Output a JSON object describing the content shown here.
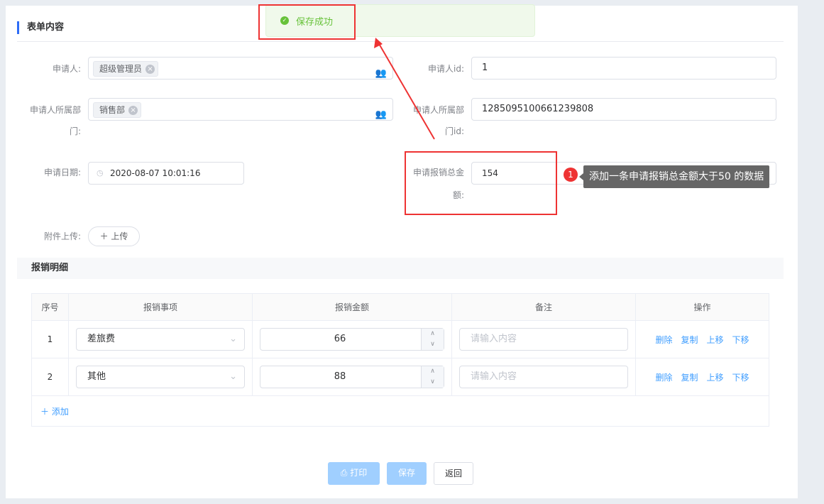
{
  "section_title": "表单内容",
  "toast": {
    "text": "保存成功"
  },
  "form": {
    "applicant_label": "申请人:",
    "applicant_tag": "超级管理员",
    "applicant_id_label": "申请人id:",
    "applicant_id": "1",
    "dept_label_1": "申请人所属部",
    "dept_label_2": "门:",
    "dept_tag": "销售部",
    "dept_id_label_1": "申请人所属部",
    "dept_id_label_2": "门id:",
    "dept_id": "1285095100661239808",
    "date_label": "申请日期:",
    "date": "2020-08-07 10:01:16",
    "total_label_1": "申请报销总金",
    "total_label_2": "额:",
    "total": "154",
    "upload_label": "附件上传:",
    "upload_button": "上传"
  },
  "annotation": {
    "badge": "1",
    "text": "添加一条申请报销总金额大于50 的数据"
  },
  "detail_title": "报销明细",
  "table": {
    "headers": [
      "序号",
      "报销事项",
      "报销金额",
      "备注",
      "操作"
    ],
    "rows": [
      {
        "no": "1",
        "item": "差旅费",
        "amount": "66",
        "remark_placeholder": "请输入内容"
      },
      {
        "no": "2",
        "item": "其他",
        "amount": "88",
        "remark_placeholder": "请输入内容"
      }
    ],
    "actions": [
      "删除",
      "复制",
      "上移",
      "下移"
    ],
    "add": "添加"
  },
  "footer": {
    "print": "打印",
    "save": "保存",
    "back": "返回"
  }
}
